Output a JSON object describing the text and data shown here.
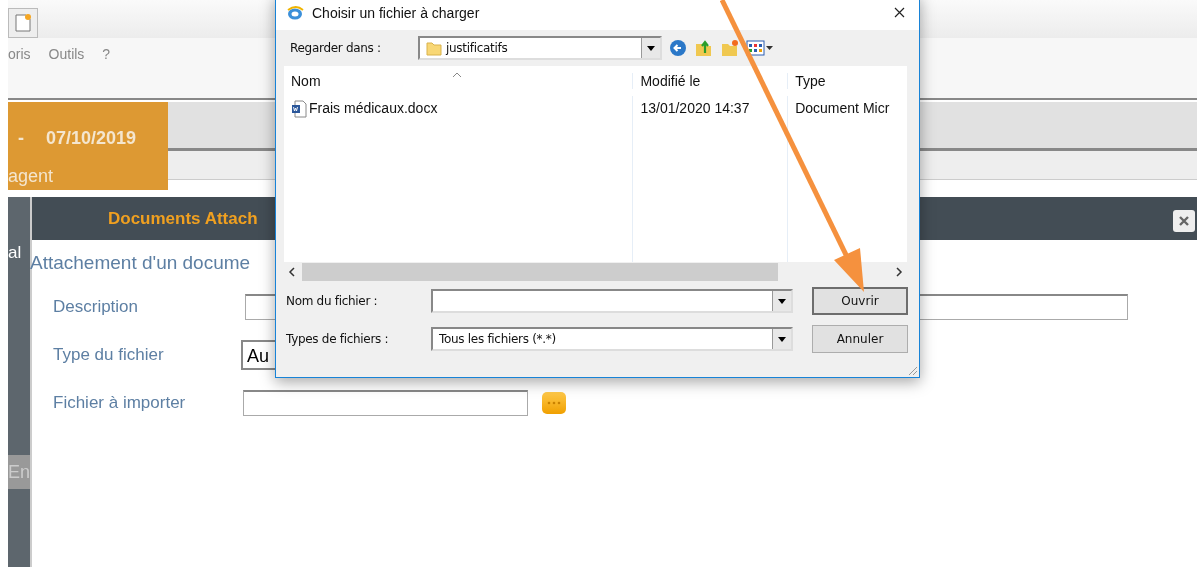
{
  "app": {
    "menu": [
      "oris",
      "Outils",
      "?"
    ],
    "date_band": {
      "separator": "-",
      "date": "07/10/2019",
      "subtitle": "agent"
    },
    "side_labels": [
      "al",
      "En"
    ]
  },
  "modal": {
    "title": "Documents Attach",
    "heading": "Attachement d'un docume",
    "fields": [
      {
        "label": "Description",
        "kind": "text"
      },
      {
        "label": "Type du fichier",
        "kind": "select",
        "value": "Au"
      },
      {
        "label": "Fichier à importer",
        "kind": "file"
      }
    ]
  },
  "dialog": {
    "title": "Choisir un fichier à charger",
    "look_in_label": "Regarder dans :",
    "look_in": "justificatifs",
    "columns": [
      "Nom",
      "Modifié le",
      "Type"
    ],
    "files": [
      {
        "name": "Frais médicaux.docx",
        "modified": "13/01/2020 14:37",
        "type": "Document Micr"
      }
    ],
    "file_name_label": "Nom du fichier :",
    "file_types_label": "Types de fichiers :",
    "file_type": "Tous les fichiers (*.*)",
    "buttons": [
      {
        "label": "Ouvrir",
        "default": true
      },
      {
        "label": "Annuler",
        "default": false
      }
    ]
  }
}
